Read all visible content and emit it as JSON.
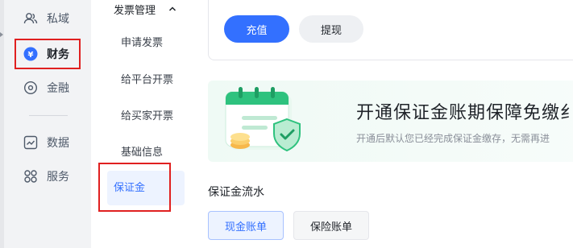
{
  "rail": {
    "items": [
      {
        "label": "私域",
        "icon": "community-icon"
      },
      {
        "label": "财务",
        "icon": "yuan-circle-icon",
        "active": true
      },
      {
        "label": "金融",
        "icon": "finance-ring-icon"
      },
      {
        "label": "数据",
        "icon": "chart-line-icon"
      },
      {
        "label": "服务",
        "icon": "grid-apps-icon"
      }
    ]
  },
  "subnav": {
    "group_title": "发票管理",
    "items": [
      "申请发票",
      "给平台开票",
      "给买家开票",
      "基础信息"
    ],
    "active_item": "保证金"
  },
  "actions": {
    "recharge": "充值",
    "withdraw": "提现"
  },
  "banner": {
    "title": "开通保证金账期保障免缴纟",
    "subtitle": "开通后默认您已经完成保证金缴存，无需再进"
  },
  "ledger": {
    "title": "保证金流水",
    "tabs": [
      {
        "label": "现金账单",
        "active": true
      },
      {
        "label": "保险账单"
      }
    ]
  },
  "colors": {
    "accent": "#3370ff",
    "highlight_box": "#e02020",
    "banner_green": "#27c07a"
  }
}
